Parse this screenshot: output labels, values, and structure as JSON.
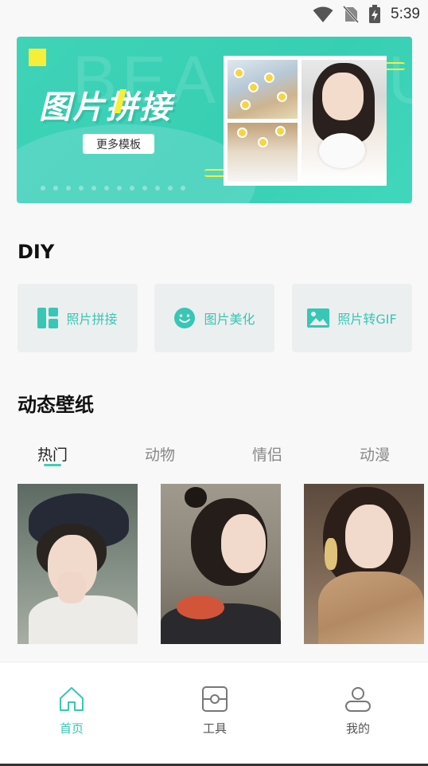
{
  "status_bar": {
    "time": "5:39",
    "icons": [
      "wifi-icon",
      "no-sim-icon",
      "battery-charging-icon"
    ]
  },
  "banner": {
    "ghost_text": "BEAUTIFUL",
    "title": "图片拼接",
    "button_label": "更多模板",
    "accent_color": "#3fd3b8",
    "highlight_color": "#f7ee3a"
  },
  "diy": {
    "title": "DIY",
    "items": [
      {
        "label": "照片拼接",
        "icon": "collage-grid-icon"
      },
      {
        "label": "图片美化",
        "icon": "smile-face-icon"
      },
      {
        "label": "照片转GIF",
        "icon": "image-icon"
      }
    ]
  },
  "wallpaper": {
    "title": "动态壁纸",
    "tabs": [
      {
        "label": "热门",
        "active": true
      },
      {
        "label": "动物",
        "active": false
      },
      {
        "label": "情侣",
        "active": false
      },
      {
        "label": "动漫",
        "active": false
      }
    ]
  },
  "bottom_nav": {
    "items": [
      {
        "label": "首页",
        "icon": "home-icon",
        "active": true
      },
      {
        "label": "工具",
        "icon": "toolbox-icon",
        "active": false
      },
      {
        "label": "我的",
        "icon": "user-icon",
        "active": false
      }
    ]
  },
  "colors": {
    "accent": "#38c6b5",
    "card_bg": "#eceff0",
    "page_bg": "#f8f8f8"
  }
}
